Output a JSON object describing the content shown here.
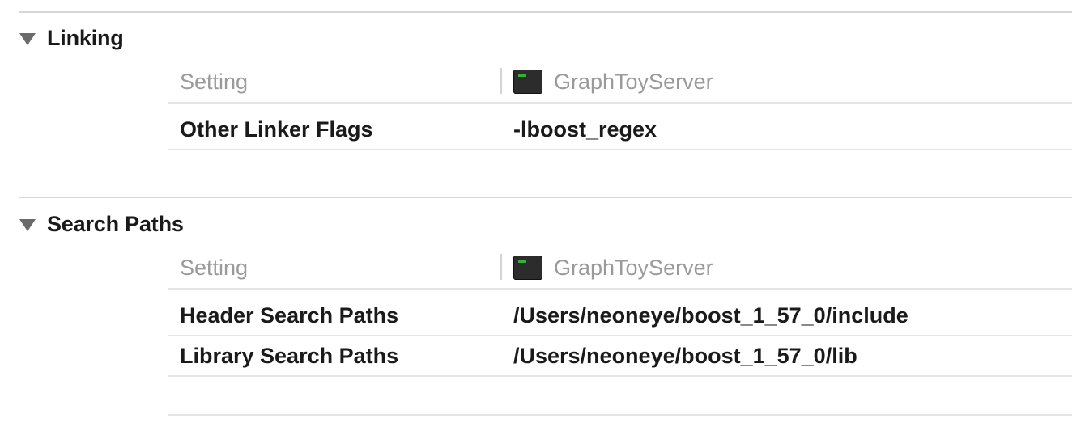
{
  "sections": [
    {
      "title": "Linking",
      "header": {
        "setting_label": "Setting",
        "target_icon": "terminal-icon",
        "target_name": "GraphToyServer"
      },
      "rows": [
        {
          "setting": "Other Linker Flags",
          "value": "-lboost_regex"
        }
      ]
    },
    {
      "title": "Search Paths",
      "header": {
        "setting_label": "Setting",
        "target_icon": "terminal-icon",
        "target_name": "GraphToyServer"
      },
      "rows": [
        {
          "setting": "Header Search Paths",
          "value": "/Users/neoneye/boost_1_57_0/include"
        },
        {
          "setting": "Library Search Paths",
          "value": "/Users/neoneye/boost_1_57_0/lib"
        }
      ]
    }
  ]
}
